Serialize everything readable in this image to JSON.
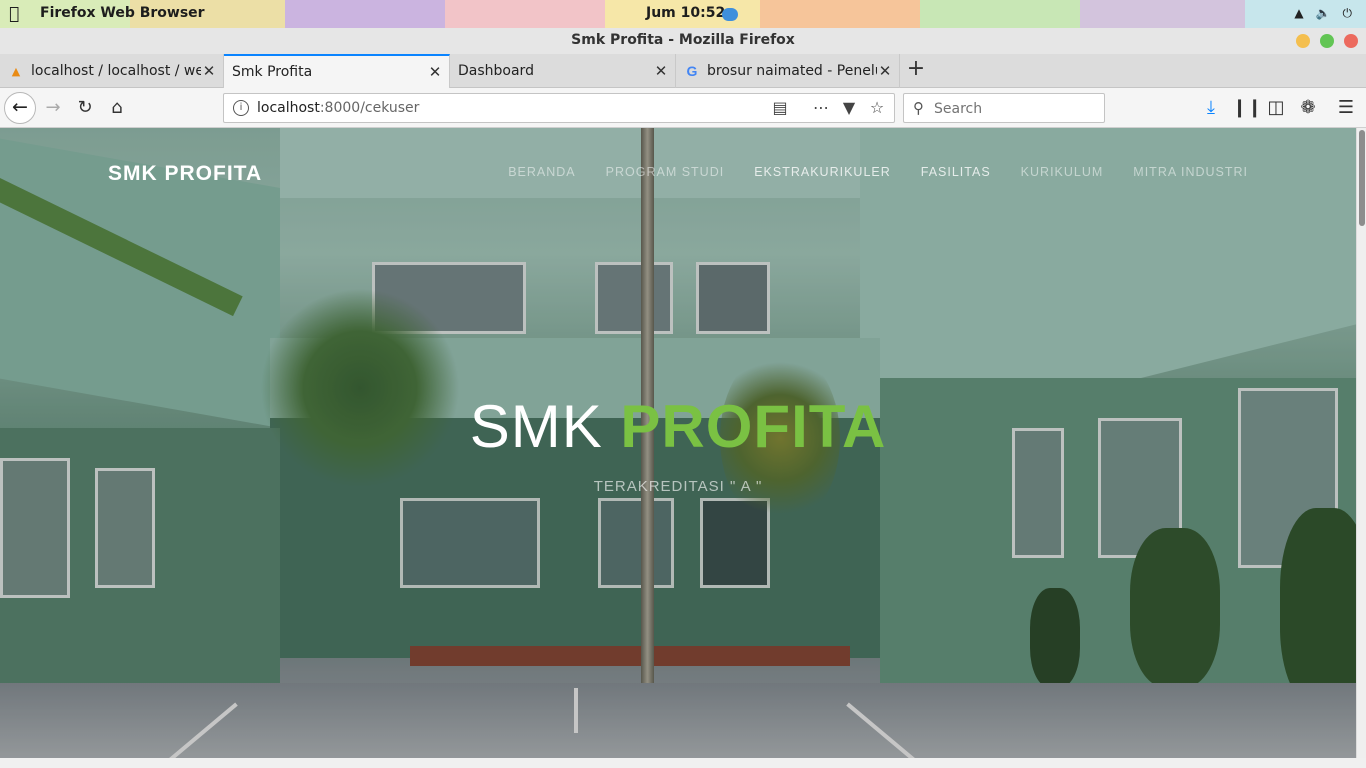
{
  "system": {
    "app_name": "Firefox Web Browser",
    "clock": "Jum 10:52"
  },
  "window": {
    "title": "Smk Profita - Mozilla Firefox"
  },
  "tabs": [
    {
      "label": "localhost / localhost / we",
      "favicon": "phpmyadmin-icon",
      "active": false
    },
    {
      "label": "Smk Profita",
      "favicon": "none",
      "active": true
    },
    {
      "label": "Dashboard",
      "favicon": "none",
      "active": false
    },
    {
      "label": "brosur naimated - Penelu",
      "favicon": "google-icon",
      "active": false
    }
  ],
  "navbar": {
    "url_host": "localhost",
    "url_rest": ":8000/cekuser",
    "search_placeholder": "Search"
  },
  "page": {
    "brand": "SMK PROFITA",
    "menu": [
      {
        "label": "BERANDA"
      },
      {
        "label": "PROGRAM STUDI"
      },
      {
        "label": "EKSTRAKURIKULER"
      },
      {
        "label": "FASILITAS"
      },
      {
        "label": "KURIKULUM"
      },
      {
        "label": "MITRA INDUSTRI"
      }
    ],
    "hero_title_part1": "SMK ",
    "hero_title_part2": "PROFITA",
    "hero_subtitle": "TERAKREDITASI \" A \""
  },
  "colors": {
    "accent": "#0a84ff",
    "hero_green": "#7ac143"
  }
}
